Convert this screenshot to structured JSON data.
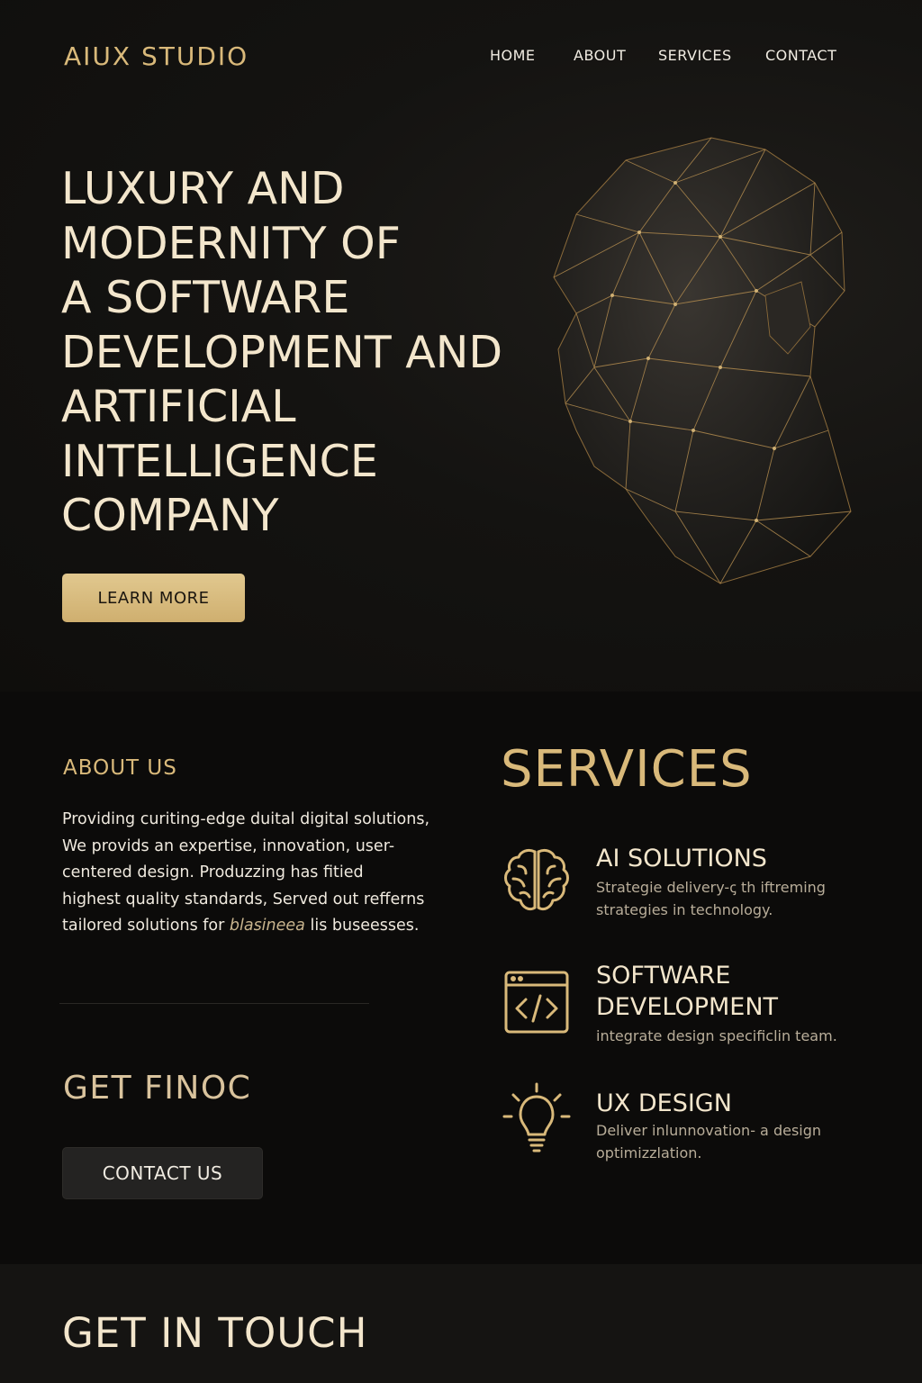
{
  "brand": {
    "logo": "AIUX STUDIO",
    "accent": "#d9b97a",
    "background": "#0f0e0c"
  },
  "nav": {
    "items": [
      "HOME",
      "ABOUT",
      "SERVICES",
      "CONTACT"
    ]
  },
  "hero": {
    "headline_lines": [
      "LUXURY AND",
      "MODERNITY OF",
      "A SOFTWARE",
      "DEVELOPMENT AND",
      "ARTIFICIAL",
      "INTELLIGENCE",
      "COMPANY"
    ],
    "cta": "LEARN MORE",
    "image": "low-poly-head-illustration"
  },
  "about": {
    "title": "ABOUT US",
    "lines": [
      "Providing curiting-edge duital digital solutions,",
      "We provids an expertise, innovation, user-",
      "centered design.  Produzzing has fitied",
      "highest quality standards, Served out refferns"
    ],
    "last_line_start": "tailored solutions for ",
    "last_line_italic": "blasineea",
    "last_line_end": " lis buseesses."
  },
  "cta_section": {
    "title": "GET FINOC",
    "button": "CONTACT US"
  },
  "services": {
    "title": "SERVICES",
    "items": [
      {
        "icon": "brain-icon",
        "title_lines": [
          "AI SOLUTIONS"
        ],
        "desc_lines": [
          "Strategie delivery-ꞔ th iftreming",
          "strategies in technology."
        ]
      },
      {
        "icon": "code-window-icon",
        "title_lines": [
          "SOFTWARE",
          "DEVELOPMENT"
        ],
        "desc_lines": [
          "integrate design specificlin team."
        ]
      },
      {
        "icon": "lightbulb-icon",
        "title_lines": [
          "UX DESIGN"
        ],
        "desc_lines": [
          "Deliver inlunnovation- a design",
          "optimizzlation."
        ]
      }
    ]
  },
  "contact": {
    "title": "GET IN TOUCH"
  }
}
